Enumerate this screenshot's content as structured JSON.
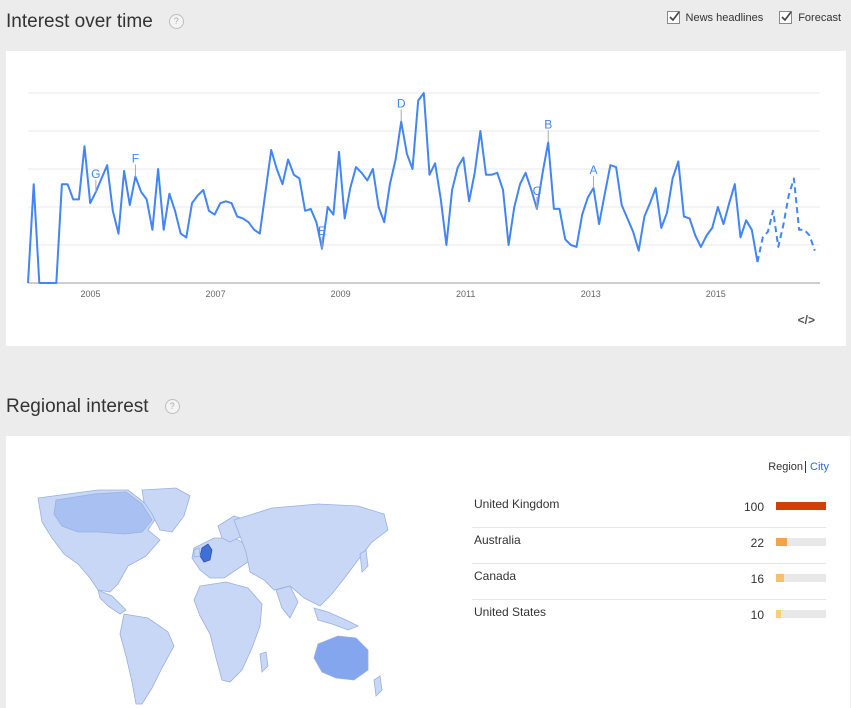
{
  "interest": {
    "title": "Interest over time",
    "help": "?",
    "options": [
      {
        "label": "News headlines",
        "checked": true
      },
      {
        "label": "Forecast",
        "checked": true
      }
    ],
    "embed_label": "</>"
  },
  "chart_data": {
    "type": "line",
    "x_ticks": [
      "2005",
      "2007",
      "2009",
      "2011",
      "2013",
      "2015"
    ],
    "ylim": [
      0,
      100
    ],
    "grid": true,
    "series": [
      {
        "style": "solid",
        "start": "2004-01",
        "end": "2015-09",
        "values": [
          0,
          52,
          0,
          0,
          0,
          0,
          52,
          52,
          44,
          44,
          72,
          42,
          48,
          55,
          62,
          38,
          26,
          59,
          41,
          56,
          48,
          44,
          28,
          60,
          28,
          47,
          38,
          26,
          24,
          42,
          46,
          49,
          38,
          36,
          42,
          43,
          42,
          35,
          34,
          32,
          28,
          26,
          48,
          70,
          60,
          52,
          65,
          57,
          55,
          38,
          39,
          32,
          18,
          40,
          36,
          69,
          34,
          50,
          61,
          58,
          54,
          60,
          40,
          32,
          52,
          65,
          85,
          68,
          60,
          96,
          100,
          57,
          63,
          44,
          20,
          49,
          61,
          66,
          43,
          58,
          80,
          57,
          57,
          58,
          49,
          20,
          40,
          52,
          58,
          49,
          39,
          58,
          74,
          39,
          39,
          23,
          20,
          19,
          36,
          45,
          50,
          31,
          47,
          62,
          61,
          41,
          34,
          27,
          17,
          35,
          42,
          50,
          29,
          37,
          55,
          64,
          35,
          34,
          25,
          19,
          25,
          29,
          40,
          31,
          42,
          52,
          24,
          33,
          28,
          11
        ]
      },
      {
        "style": "dashed",
        "start": "2015-09",
        "end": "2016-08",
        "values": [
          11,
          24,
          27,
          38,
          19,
          31,
          46,
          55,
          28,
          28,
          25,
          17
        ]
      }
    ],
    "annotations": [
      {
        "letter": "G",
        "x": "2005-02"
      },
      {
        "letter": "F",
        "x": "2005-10"
      },
      {
        "letter": "E",
        "x": "2008-09"
      },
      {
        "letter": "D",
        "x": "2010-01"
      },
      {
        "letter": "C",
        "x": "2012-03"
      },
      {
        "letter": "B",
        "x": "2012-05"
      },
      {
        "letter": "A",
        "x": "2013-02"
      }
    ],
    "color": "#4285f4"
  },
  "regional": {
    "title": "Regional interest",
    "help": "?",
    "toggle": {
      "region": "Region",
      "city": "City"
    },
    "rows": [
      {
        "name": "United Kingdom",
        "value": "100",
        "pct": 100,
        "color": "#d04108"
      },
      {
        "name": "Australia",
        "value": "22",
        "pct": 22,
        "color": "#f0a54b"
      },
      {
        "name": "Canada",
        "value": "16",
        "pct": 16,
        "color": "#f7c06a"
      },
      {
        "name": "United States",
        "value": "10",
        "pct": 10,
        "color": "#f9cf72"
      }
    ],
    "map_colors": {
      "land": "#c9d7f7",
      "border": "#9ab0e0",
      "mid": "#a9c0f2",
      "aus": "#84a6ee",
      "uk": "#3f6fd8"
    }
  }
}
